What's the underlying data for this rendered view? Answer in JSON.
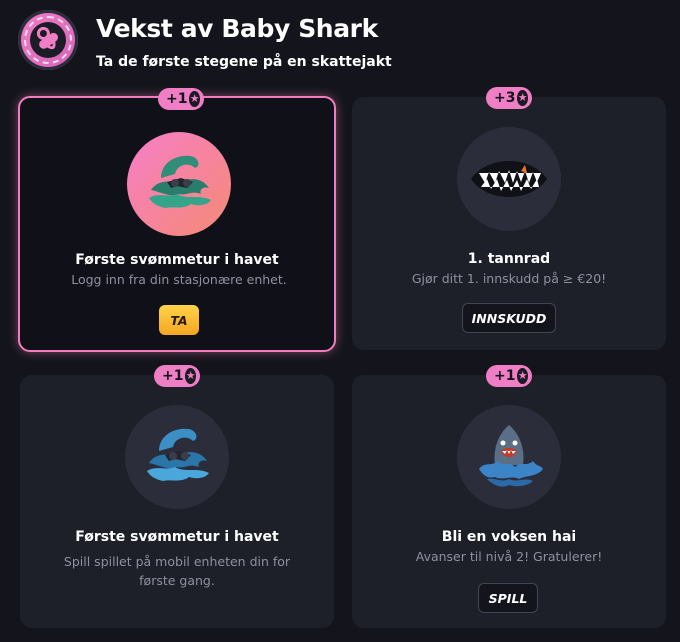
{
  "header": {
    "title": "Vekst av Baby Shark",
    "subtitle": "Ta de første stegene på en skattejakt",
    "badge_icon": "pacifier-icon"
  },
  "colors": {
    "accent_pink": "#f07ec5",
    "background": "#14151c",
    "card": "#1e2029",
    "gold_button": "#f5a623"
  },
  "cards": [
    {
      "reward": "+1",
      "reward_icon": "star-icon",
      "icon": "wave-with-sunglasses-icon",
      "title": "Første svømmetur i havet",
      "description": "Logg inn fra din stasjonære enhet.",
      "button": "TA",
      "state": "active"
    },
    {
      "reward": "+3",
      "reward_icon": "star-icon",
      "icon": "shark-teeth-icon",
      "title": "1. tannrad",
      "description": "Gjør ditt 1. innskudd på ≥ €20!",
      "button": "INNSKUDD",
      "state": "inactive"
    },
    {
      "reward": "+1",
      "reward_icon": "star-icon",
      "icon": "blue-wave-with-sunglasses-icon",
      "title": "Første svømmetur i havet",
      "description": "Spill spillet på mobil enheten din for første gang.",
      "button": "",
      "state": "inactive"
    },
    {
      "reward": "+1",
      "reward_icon": "star-icon",
      "icon": "shark-splash-icon",
      "title": "Bli en voksen hai",
      "description": "Avanser til nivå 2! Gratulerer!",
      "button": "SPILL",
      "state": "inactive"
    }
  ]
}
